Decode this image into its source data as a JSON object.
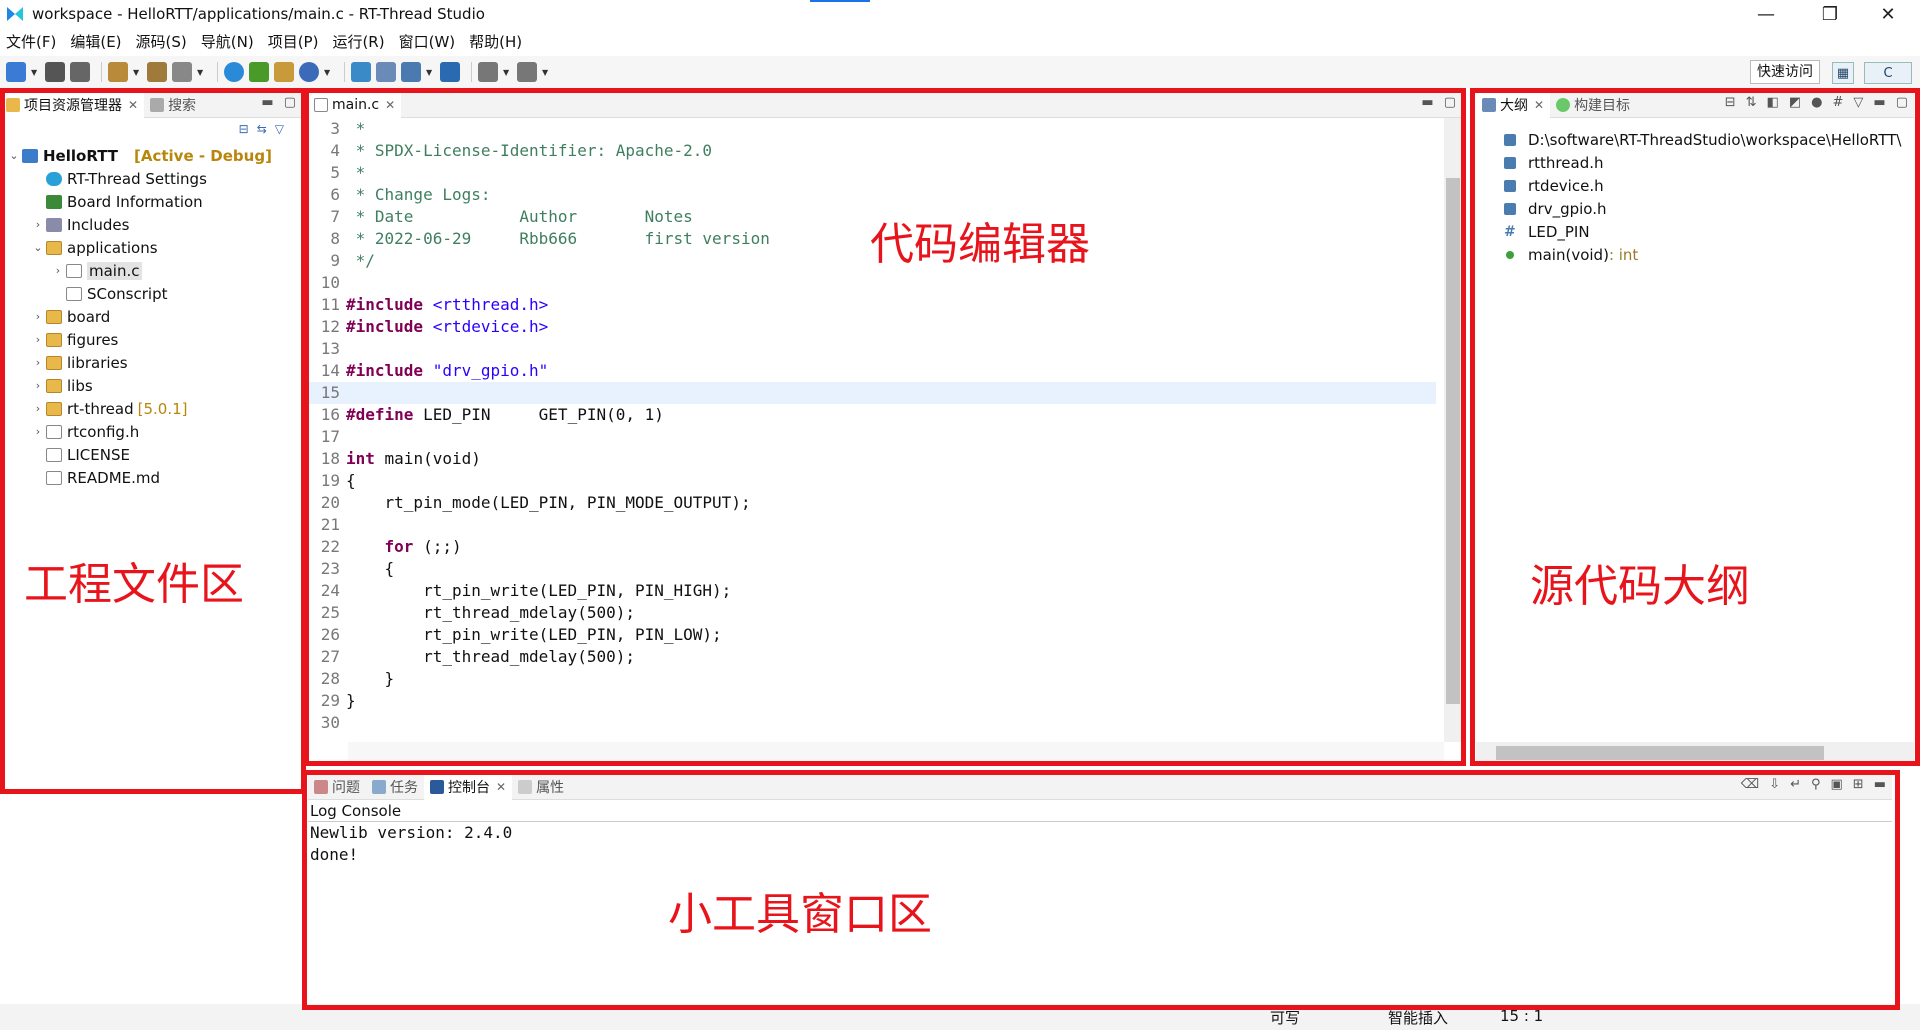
{
  "window": {
    "title": "workspace - HelloRTT/applications/main.c - RT-Thread Studio",
    "minimize": "—",
    "maximize": "❐",
    "close": "✕"
  },
  "menu": [
    "文件(F)",
    "编辑(E)",
    "源码(S)",
    "导航(N)",
    "项目(P)",
    "运行(R)",
    "窗口(W)",
    "帮助(H)"
  ],
  "toolbar": {
    "quick_access": "快速访问",
    "perspective_label": "C"
  },
  "project_explorer": {
    "tab_label": "项目资源管理器",
    "search_tab": "搜索",
    "project_name": "HelloRTT",
    "project_status": "[Active - Debug]",
    "items": [
      {
        "label": "RT-Thread Settings"
      },
      {
        "label": "Board Information"
      },
      {
        "label": "Includes"
      },
      {
        "label": "applications"
      },
      {
        "label": "main.c"
      },
      {
        "label": "SConscript"
      },
      {
        "label": "board"
      },
      {
        "label": "figures"
      },
      {
        "label": "libraries"
      },
      {
        "label": "libs"
      },
      {
        "label": "rt-thread",
        "version": "[5.0.1]"
      },
      {
        "label": "rtconfig.h"
      },
      {
        "label": "LICENSE"
      },
      {
        "label": "README.md"
      }
    ]
  },
  "editor": {
    "tab_label": "main.c",
    "lines": [
      {
        "n": "3",
        "text": " *"
      },
      {
        "n": "4",
        "text": " * SPDX-License-Identifier: Apache-2.0"
      },
      {
        "n": "5",
        "text": " *"
      },
      {
        "n": "6",
        "text": " * Change Logs:"
      },
      {
        "n": "7",
        "text": " * Date           Author       Notes"
      },
      {
        "n": "8",
        "text": " * 2022-06-29     Rbb666       first version"
      },
      {
        "n": "9",
        "text": " */"
      },
      {
        "n": "10",
        "text": ""
      },
      {
        "n": "11",
        "kw": "#include",
        "rest": " <rtthread.h>"
      },
      {
        "n": "12",
        "kw": "#include",
        "rest": " <rtdevice.h>"
      },
      {
        "n": "13",
        "text": ""
      },
      {
        "n": "14",
        "kw": "#include",
        "rest": " \"drv_gpio.h\""
      },
      {
        "n": "15",
        "text": ""
      },
      {
        "n": "16",
        "kw": "#define",
        "rest": " LED_PIN     GET_PIN(0, 1)"
      },
      {
        "n": "17",
        "text": ""
      },
      {
        "n": "18",
        "kw": "int",
        "rest": " main(void)"
      },
      {
        "n": "19",
        "text": "{"
      },
      {
        "n": "20",
        "text": "    rt_pin_mode(LED_PIN, PIN_MODE_OUTPUT);"
      },
      {
        "n": "21",
        "text": ""
      },
      {
        "n": "22",
        "pre": "    ",
        "kw": "for",
        "rest": " (;;)"
      },
      {
        "n": "23",
        "text": "    {"
      },
      {
        "n": "24",
        "text": "        rt_pin_write(LED_PIN, PIN_HIGH);"
      },
      {
        "n": "25",
        "text": "        rt_thread_mdelay(500);"
      },
      {
        "n": "26",
        "text": "        rt_pin_write(LED_PIN, PIN_LOW);"
      },
      {
        "n": "27",
        "text": "        rt_thread_mdelay(500);"
      },
      {
        "n": "28",
        "text": "    }"
      },
      {
        "n": "29",
        "text": "}"
      },
      {
        "n": "30",
        "text": ""
      }
    ]
  },
  "outline": {
    "tab_label": "大纲",
    "build_tab": "构建目标",
    "items": [
      {
        "label": "D:\\software\\RT-ThreadStudio\\workspace\\HelloRTT\\"
      },
      {
        "label": "rtthread.h"
      },
      {
        "label": "rtdevice.h"
      },
      {
        "label": "drv_gpio.h"
      },
      {
        "label": "LED_PIN"
      },
      {
        "label": "main(void)",
        "type": " : int"
      }
    ]
  },
  "console": {
    "tabs": [
      "问题",
      "任务",
      "控制台",
      "属性"
    ],
    "title": "Log Console",
    "lines": [
      "Newlib version: 2.4.0",
      "done!"
    ]
  },
  "status": {
    "writable": "可写",
    "insert_mode": "智能插入",
    "position": "15 : 1"
  },
  "annotations": {
    "editor": "代码编辑器",
    "project": "工程文件区",
    "outline": "源代码大纲",
    "tools": "小工具窗口区"
  }
}
